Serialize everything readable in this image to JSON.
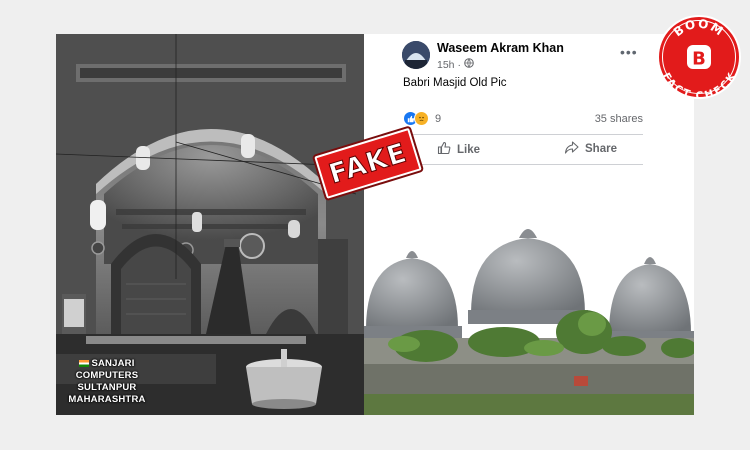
{
  "post": {
    "author": "Waseem Akram Khan",
    "time": "15h",
    "audience_icon": "globe-icon",
    "text": "Babri Masjid Old Pic",
    "reaction_icons": [
      "like-icon",
      "sad-icon"
    ],
    "reaction_count": "9",
    "shares": "35 shares",
    "actions": {
      "like": "Like",
      "share": "Share"
    }
  },
  "stamp": {
    "label": "FAKE",
    "color": "#e21b1b"
  },
  "badge": {
    "top_text": "BOOM",
    "letter": "B",
    "bottom_text": "FACT CHECK",
    "color": "#e21b1b"
  },
  "watermark": {
    "lines": [
      "SANJARI",
      "COMPUTERS",
      "SULTANPUR",
      "MAHARASHTRA"
    ]
  }
}
